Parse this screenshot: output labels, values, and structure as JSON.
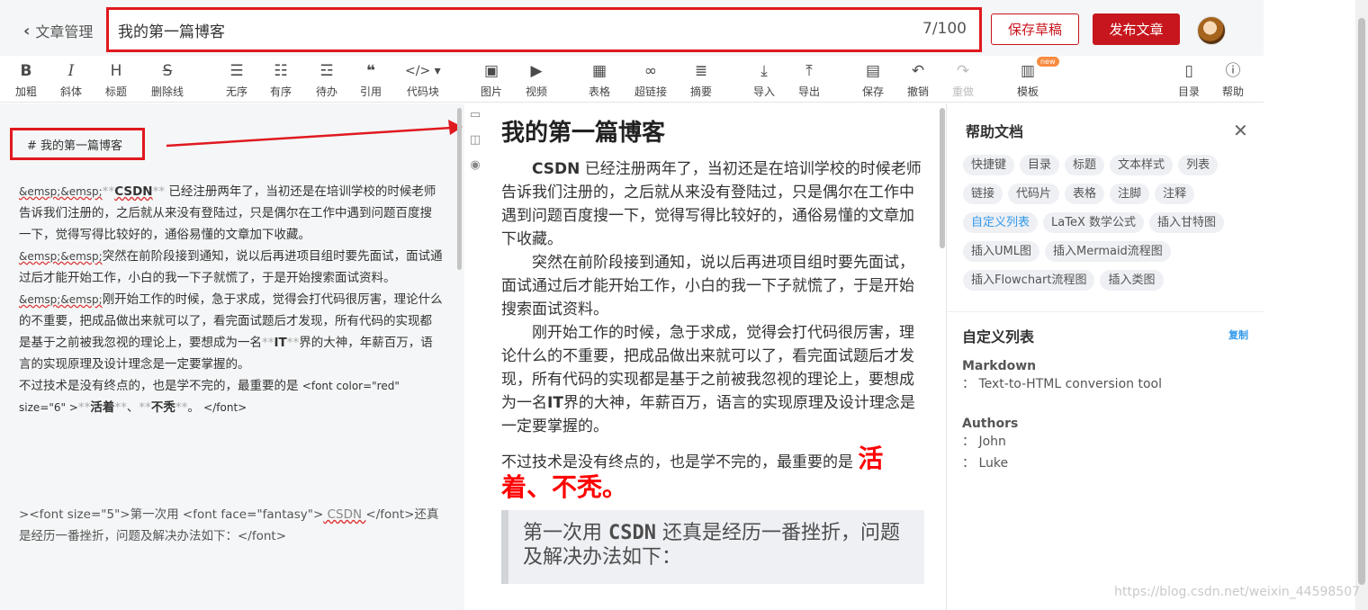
{
  "header": {
    "back_label": "文章管理",
    "title_value": "我的第一篇博客",
    "title_count": "7/100",
    "save_draft": "保存草稿",
    "publish": "发布文章"
  },
  "toolbar": {
    "bold": "加粗",
    "italic": "斜体",
    "heading": "标题",
    "strike": "删除线",
    "unordered": "无序",
    "ordered": "有序",
    "todo": "待办",
    "quote": "引用",
    "code": "代码块",
    "image": "图片",
    "video": "视频",
    "table": "表格",
    "link": "超链接",
    "summary": "摘要",
    "import": "导入",
    "export": "导出",
    "save": "保存",
    "undo": "撤销",
    "redo": "重做",
    "template": "模板",
    "template_badge": "new",
    "toc": "目录",
    "help": "帮助"
  },
  "editor": {
    "heading_md": "# 我的第一篇博客",
    "p1_ent": "&emsp;&emsp;",
    "p1_mark": "**",
    "p1_bold": "CSDN",
    "p1_text": " 已经注册两年了，当初还是在培训学校的时候老师告诉我们注册的，之后就从来没有登陆过，只是偶尔在工作中遇到问题百度搜一下，觉得写得比较好的，通俗易懂的文章加下收藏。",
    "p2_text": "突然在前阶段接到通知，说以后再进项目组时要先面试，面试通过后才能开始工作，小白的我一下子就慌了，于是开始搜索面试资料。",
    "p3_a": "刚开始工作的时候，急于求成，觉得会打代码很厉害，理论什么的不重要，把成品做出来就可以了，看完面试题后才发现，所有代码的实现都是基于之前被我忽视的理论上，要想成为一名",
    "p3_it": "IT",
    "p3_b": "界的大神，年薪百万，语言的实现原理及设计理念是一定要掌握的。",
    "p4_a": "不过技术是没有终点的，也是学不完的，最重要的是 ",
    "p4_tag": "<font color=\"red\" size=\"6\" >",
    "p4_w1": "活着",
    "p4_sep": "、",
    "p4_w2": "不秃",
    "p4_end": "。",
    "p4_close": "</font>",
    "q_gt": ">",
    "q_tag1": "<font size=\"5\">",
    "q_t1": "第一次用 ",
    "q_tag2": "<font face=\"fantasy\">",
    "q_csdn": " CSDN ",
    "q_tag3": "</font>",
    "q_t2": "还真是经历一番挫折，问题及解决办法如下：",
    "q_tag4": "</font>"
  },
  "preview": {
    "title": "我的第一篇博客",
    "p1_bold": "CSDN",
    "p1_text": " 已经注册两年了，当初还是在培训学校的时候老师告诉我们注册的，之后就从来没有登陆过，只是偶尔在工作中遇到问题百度搜一下，觉得写得比较好的，通俗易懂的文章加下收藏。",
    "p2_text": "突然在前阶段接到通知，说以后再进项目组时要先面试，面试通过后才能开始工作，小白的我一下子就慌了，于是开始搜索面试资料。",
    "p3_a": "刚开始工作的时候，急于求成，觉得会打代码很厉害，理论什么的不重要，把成品做出来就可以了，看完面试题后才发现，所有代码的实现都是基于之前被我忽视的理论上，要想成为一名",
    "p3_it": "IT",
    "p3_b": "界的大神，年薪百万，语言的实现原理及设计理念是一定要掌握的。",
    "p4_a": "不过技术是没有终点的，也是学不完的，最重要的是 ",
    "p4_red": "活着、不秃。",
    "quote_a": "第一次用 ",
    "quote_csdn": "CSDN",
    "quote_b": " 还真是经历一番挫折，问题及解决办法如下："
  },
  "help": {
    "title": "帮助文档",
    "chips": [
      "快捷键",
      "目录",
      "标题",
      "文本样式",
      "列表",
      "链接",
      "代码片",
      "表格",
      "注脚",
      "注释",
      "自定义列表",
      "LaTeX 数学公式",
      "插入甘特图",
      "插入UML图",
      "插入Mermaid流程图",
      "插入Flowchart流程图",
      "插入类图"
    ],
    "section_title": "自定义列表",
    "copy": "复制",
    "term1": "Markdown",
    "def1": "：  Text-to-HTML conversion tool",
    "term2": "Authors",
    "def2a": "：  John",
    "def2b": "：  Luke"
  },
  "watermark": "https://blog.csdn.net/weixin_44598507",
  "colors": {
    "accent_red": "#c7161d",
    "annotation_red": "#e0191f",
    "link_blue": "#3399ea"
  }
}
